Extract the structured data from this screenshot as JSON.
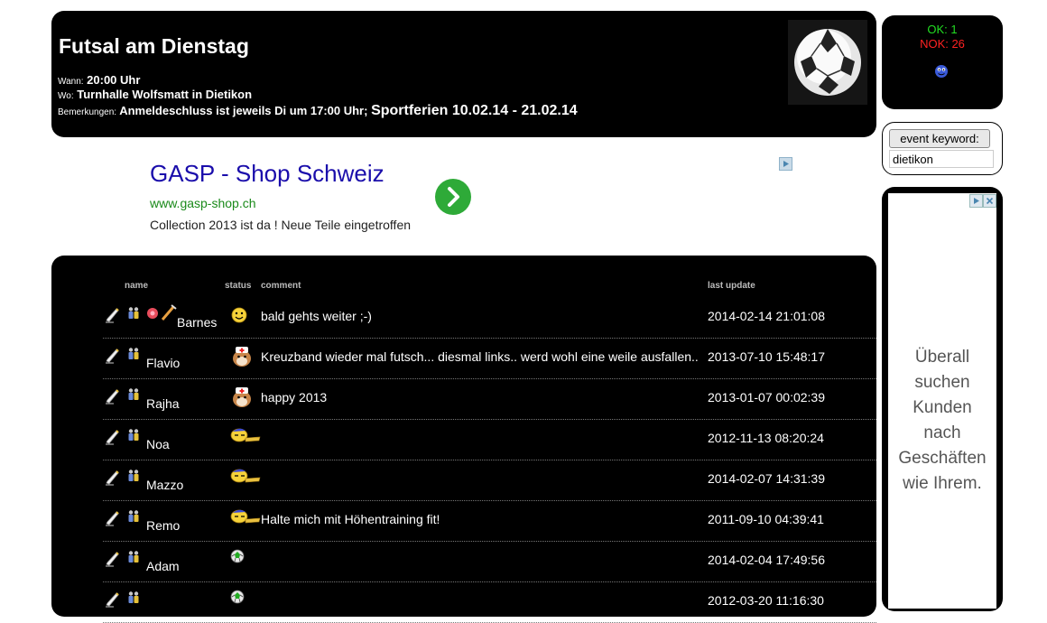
{
  "header": {
    "title": "Futsal am Dienstag",
    "when_label": "Wann:",
    "when_value": "20:00 Uhr",
    "where_label": "Wo:",
    "where_value": "Turnhalle Wolfsmatt in Dietikon",
    "remarks_label": "Bemerkungen:",
    "remarks_value": "Anmeldeschluss ist jeweils Di um 17:00 Uhr;",
    "remarks_highlight": "Sportferien 10.02.14 - 21.02.14"
  },
  "status": {
    "ok": "OK: 1",
    "nok": "NOK: 26"
  },
  "keyword": {
    "button": "event keyword:",
    "value": "dietikon"
  },
  "ad": {
    "title": "GASP - Shop Schweiz",
    "url": "www.gasp-shop.ch",
    "description": "Collection 2013 ist da ! Neue Teile eingetroffen"
  },
  "side_ad": {
    "lines": [
      "Überall",
      "suchen",
      "Kunden",
      "nach",
      "Geschäften",
      "wie Ihrem."
    ]
  },
  "table": {
    "columns": {
      "name": "name",
      "status": "status",
      "comment": "comment",
      "last_update": "last update"
    },
    "rows": [
      {
        "name": "Barnes",
        "status_icon": "happy-smiley-icon",
        "comment": "bald gehts weiter ;-)",
        "date": "2014-02-14 21:01:08"
      },
      {
        "name": "Flavio",
        "status_icon": "nurse-dog-icon",
        "comment": "Kreuzband wieder mal futsch... diesmal links.. werd wohl eine weile ausfallen..",
        "date": "2013-07-10 15:48:17"
      },
      {
        "name": "Rajha",
        "status_icon": "nurse-dog-icon",
        "comment": "happy 2013",
        "date": "2013-01-07 00:02:39"
      },
      {
        "name": "Noa",
        "status_icon": "sleeping-smiley-icon",
        "comment": "",
        "date": "2012-11-13 08:20:24"
      },
      {
        "name": "Mazzo",
        "status_icon": "sleeping-smiley-icon",
        "comment": "",
        "date": "2014-02-07 14:31:39"
      },
      {
        "name": "Remo",
        "status_icon": "sleeping-smiley-icon",
        "comment": "Halte mich mit Höhentraining fit!",
        "date": "2011-09-10 04:39:41"
      },
      {
        "name": "Adam",
        "status_icon": "ball-icon",
        "comment": "",
        "date": "2014-02-04 17:49:56"
      },
      {
        "name": "",
        "status_icon": "ball-icon",
        "comment": "",
        "date": "2012-03-20 11:16:30"
      }
    ]
  }
}
